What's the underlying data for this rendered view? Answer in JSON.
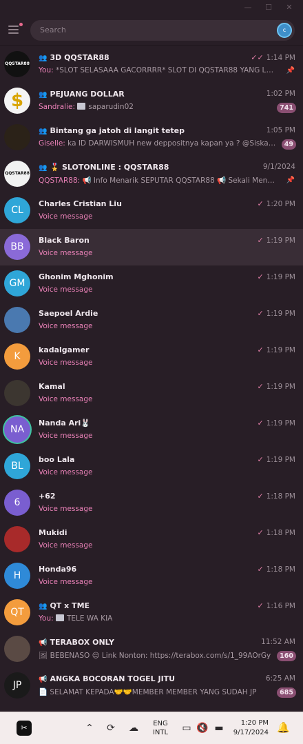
{
  "window": {
    "controls": {
      "minimize": "—",
      "maximize": "☐",
      "close": "✕"
    }
  },
  "search": {
    "placeholder": "Search",
    "account_initial": "c"
  },
  "chats": [
    {
      "name": "3D QQSTAR88",
      "group": true,
      "time": "1:14 PM",
      "check": "double",
      "sender": "You:",
      "preview": " *SLOT SELASAAA GACORRRR*  SLOT DI QQSTAR88 YANG LAGI GACOR",
      "pinned": true,
      "avatar_text": "QQSTAR88",
      "avatar_color": "#111111"
    },
    {
      "name": "PEJUANG DOLLAR",
      "group": true,
      "time": "1:02 PM",
      "sender": "Sandralie:",
      "preview": "saparudin02",
      "thumb": true,
      "badge": "741",
      "avatar_text": "$",
      "avatar_color": "#f4f4f4"
    },
    {
      "name": "Bintang ga jatoh di langit tetep",
      "group": true,
      "time": "1:05 PM",
      "sender": "Giselle:",
      "preview": " ka ID DARWISMUH new deppositnya kapan ya ? @Siskambr",
      "badge": "49",
      "avatar_text": "",
      "avatar_color": "#2b2218"
    },
    {
      "name": "🎖️ SLOTONLINE : QQSTAR88",
      "group": true,
      "time": "9/1/2024",
      "sender": "QQSTAR88:",
      "preview": " 📢 Info Menarik SEPUTAR QQSTAR88 📢  Sekali Menang Langsung",
      "pinned": true,
      "avatar_text": "QQSTAR88",
      "avatar_color": "#f2f2f2"
    },
    {
      "name": "Charles Cristian Liu",
      "time": "1:20 PM",
      "check": "single",
      "voice": "Voice message",
      "avatar_text": "CL",
      "avatar_color": "#2fa6d8"
    },
    {
      "name": "Black Baron",
      "time": "1:19 PM",
      "check": "single",
      "voice": "Voice message",
      "avatar_text": "BB",
      "avatar_color": "#8a6ad8",
      "selected": true
    },
    {
      "name": "Ghonim Mghonim",
      "time": "1:19 PM",
      "check": "single",
      "voice": "Voice message",
      "avatar_text": "GM",
      "avatar_color": "#2fa6d8"
    },
    {
      "name": "Saepoel Ardie",
      "time": "1:19 PM",
      "check": "single",
      "voice": "Voice message",
      "avatar_text": "",
      "avatar_color": "#4a79b0"
    },
    {
      "name": "kadalgamer",
      "time": "1:19 PM",
      "check": "single",
      "voice": "Voice message",
      "avatar_text": "K",
      "avatar_color": "#f39c3d"
    },
    {
      "name": "Kamal",
      "time": "1:19 PM",
      "check": "single",
      "voice": "Voice message",
      "avatar_text": "",
      "avatar_color": "#3c3630"
    },
    {
      "name": "Nanda Ari🐰",
      "time": "1:19 PM",
      "check": "single",
      "voice": "Voice message",
      "avatar_text": "NA",
      "avatar_color": "#7a5ed0",
      "ring": true
    },
    {
      "name": "boo Lala",
      "time": "1:19 PM",
      "check": "single",
      "voice": "Voice message",
      "avatar_text": "BL",
      "avatar_color": "#2fa6d8"
    },
    {
      "name": "+62",
      "time": "1:18 PM",
      "check": "single",
      "voice": "Voice message",
      "avatar_text": "6",
      "avatar_color": "#7a5ed0"
    },
    {
      "name": "Mukidi",
      "time": "1:18 PM",
      "check": "single",
      "voice": "Voice message",
      "avatar_text": "",
      "avatar_color": "#a82a2a"
    },
    {
      "name": "Honda96",
      "time": "1:18 PM",
      "check": "single",
      "voice": "Voice message",
      "avatar_text": "H",
      "avatar_color": "#2f8ad8"
    },
    {
      "name": "QT x TME",
      "group": true,
      "time": "1:16 PM",
      "check": "single",
      "sender": "You:",
      "preview": "TELE WA KIA",
      "thumb": true,
      "avatar_text": "QT",
      "avatar_color": "#f39c3d"
    },
    {
      "name": "TERABOX ONLY",
      "channel": true,
      "time": "11:52 AM",
      "preview": "🖼 BEBENASO 😌  Link Nonton: https://terabox.com/s/1_99AOrGy",
      "badge": "160",
      "avatar_text": "",
      "avatar_color": "#5a4a44"
    },
    {
      "name": "ANGKA BOCORAN TOGEL JITU",
      "channel": true,
      "time": "6:25 AM",
      "preview": "📄 SELAMAT KEPADA🤝🤝MEMBER MEMBER YANG SUDAH JP",
      "badge": "685",
      "avatar_text": "JP",
      "avatar_color": "#1a1a1a"
    }
  ],
  "taskbar": {
    "lang_top": "ENG",
    "lang_bottom": "INTL",
    "time": "1:20 PM",
    "date": "9/17/2024"
  },
  "colors": {
    "accent": "#e880b6",
    "badge": "#8a4f72",
    "background": "#281e26"
  }
}
